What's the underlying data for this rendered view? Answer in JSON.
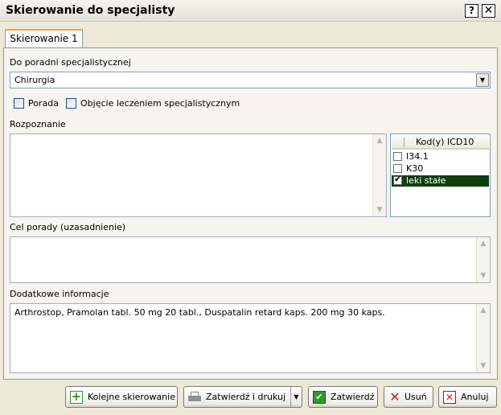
{
  "window": {
    "title": "Skierowanie do specjalisty",
    "help_glyph": "?",
    "close_glyph": "✕"
  },
  "tab": {
    "label": "Skierowanie 1"
  },
  "form": {
    "clinic_label": "Do poradni specjalistycznej",
    "clinic_value": "Chirurgia",
    "clinic_arrow": "▼",
    "consult_label": "Porada",
    "consult_checked": false,
    "treatment_label": "Objęcie leczeniem specjalistycznym",
    "treatment_checked": false,
    "diagnosis_label": "Rozpoznanie",
    "diagnosis_value": "",
    "purpose_label": "Cel porady (uzasadnienie)",
    "purpose_value": "",
    "extra_label": "Dodatkowe informacje",
    "extra_value": "Arthrostop, Pramolan tabl.  50 mg 20 tabl., Duspatalin retard kaps.  200 mg 30 kaps.",
    "scroll_up": "▲",
    "scroll_down": "▼"
  },
  "icd": {
    "header": "Kod(y) ICD10",
    "rows": [
      {
        "code": "I34.1",
        "checked": false,
        "selected": false
      },
      {
        "code": "K30",
        "checked": false,
        "selected": false
      },
      {
        "code": "leki stałe",
        "checked": true,
        "selected": true
      }
    ]
  },
  "buttons": {
    "next_referral": "Kolejne skierowanie",
    "confirm_print": "Zatwierdź i drukuj",
    "confirm_print_arrow": "▼",
    "confirm": "Zatwierdź",
    "delete": "Usuń",
    "cancel": "Anuluj"
  },
  "icons": {
    "plus": "+",
    "check": "✔",
    "x": "✕"
  },
  "colors": {
    "background": "#ece9d8",
    "tab_accent": "#f1a93a",
    "selected_row": "#0f3f0f",
    "delete_red": "#d11a1a",
    "confirm_green": "#2e9a2e"
  }
}
